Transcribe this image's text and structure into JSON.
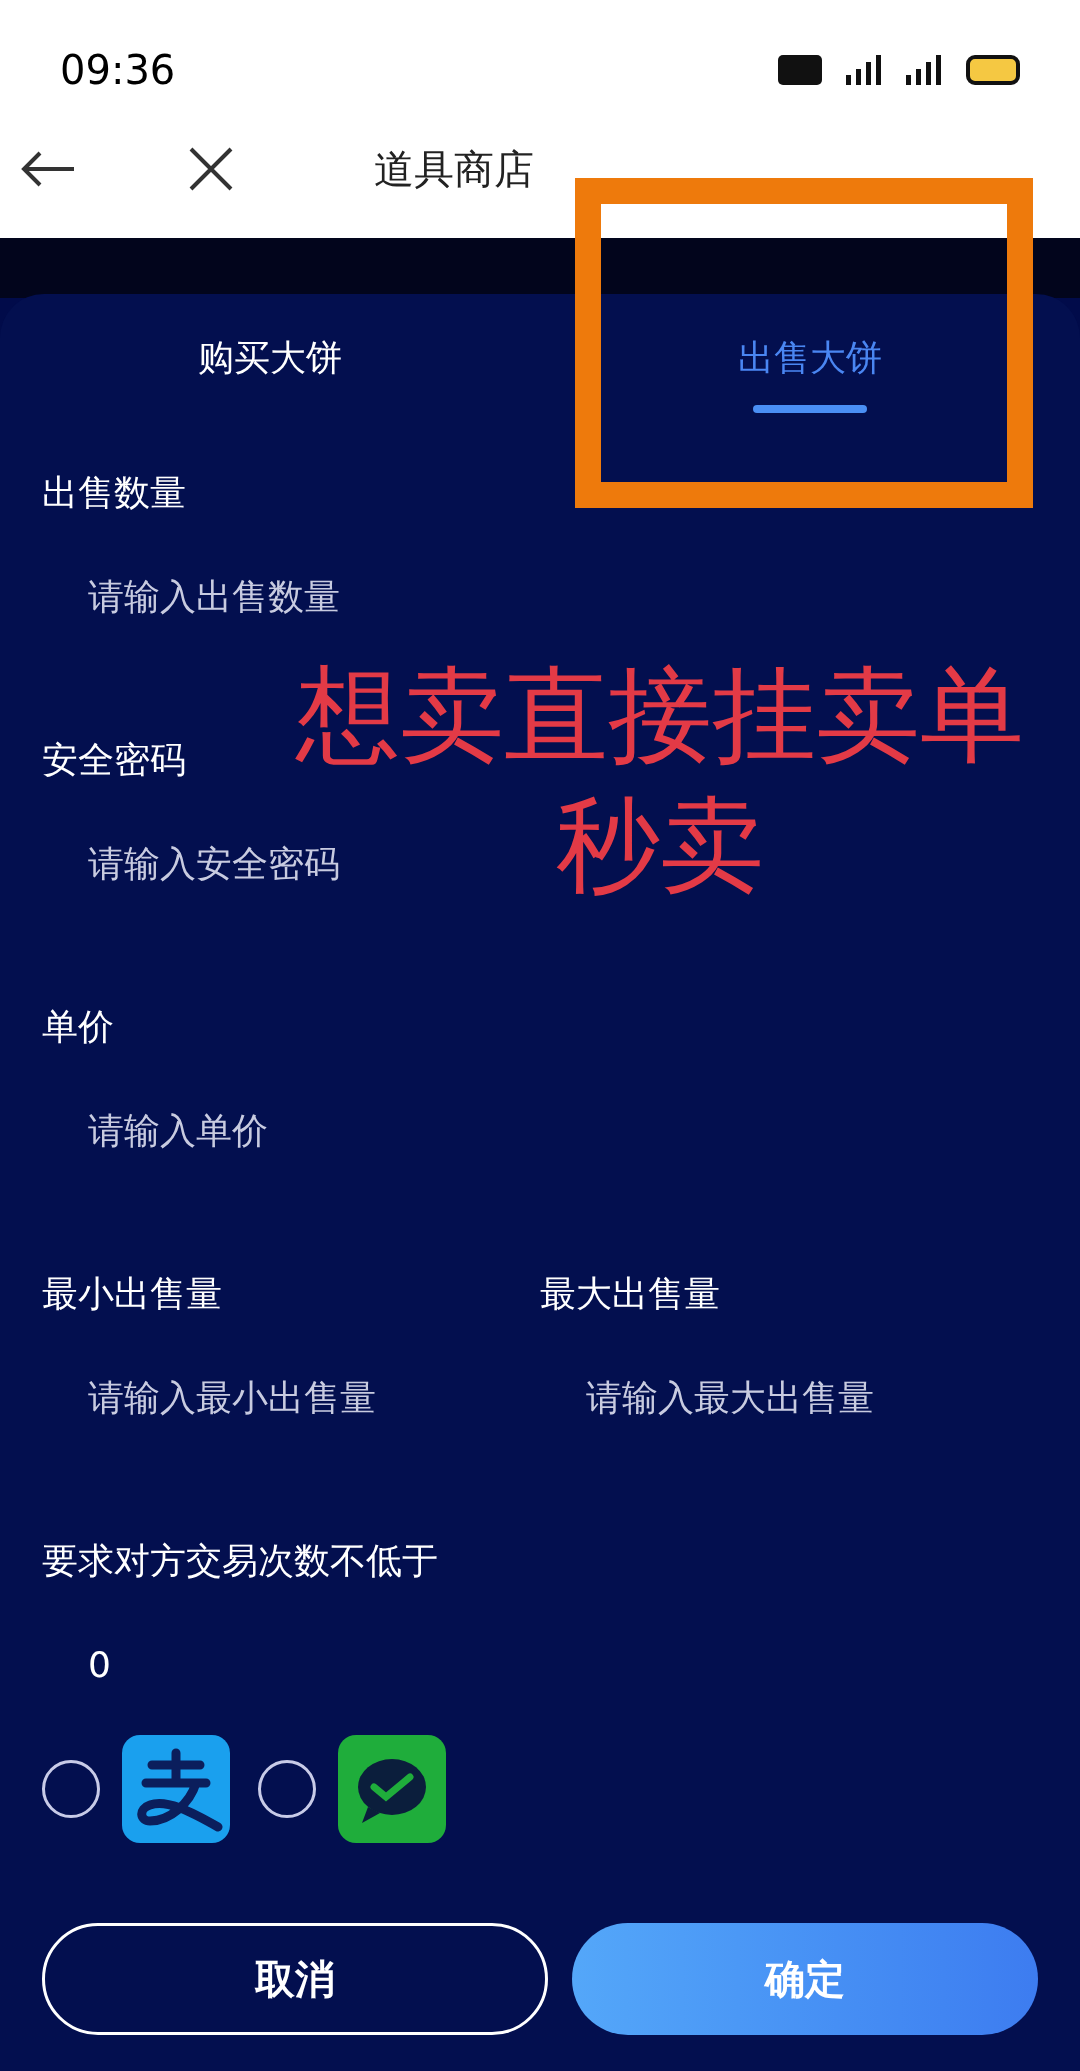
{
  "status_bar": {
    "time": "09:36"
  },
  "nav": {
    "title": "道具商店"
  },
  "tabs": [
    {
      "label": "购买大饼",
      "selected": false
    },
    {
      "label": "出售大饼",
      "selected": true
    }
  ],
  "form": {
    "rows": [
      {
        "fields": [
          {
            "label": "出售数量",
            "placeholder": "请输入出售数量"
          }
        ]
      },
      {
        "fields": [
          {
            "label": "安全密码",
            "placeholder": "请输入安全密码"
          }
        ]
      },
      {
        "fields": [
          {
            "label": "单价",
            "placeholder": "请输入单价"
          }
        ]
      },
      {
        "fields": [
          {
            "label": "最小出售量",
            "placeholder": "请输入最小出售量"
          },
          {
            "label": "最大出售量",
            "placeholder": "请输入最大出售量"
          }
        ]
      },
      {
        "fields": [
          {
            "label": "要求对方交易次数不低于",
            "value": "0"
          }
        ]
      }
    ]
  },
  "payment_methods": [
    {
      "kind": "alipay",
      "selected": false
    },
    {
      "kind": "wechat",
      "selected": false
    }
  ],
  "buttons": {
    "cancel": "取消",
    "confirm": "确定"
  },
  "annotation": {
    "lines": [
      "想卖直接挂卖单",
      "秒卖"
    ]
  }
}
